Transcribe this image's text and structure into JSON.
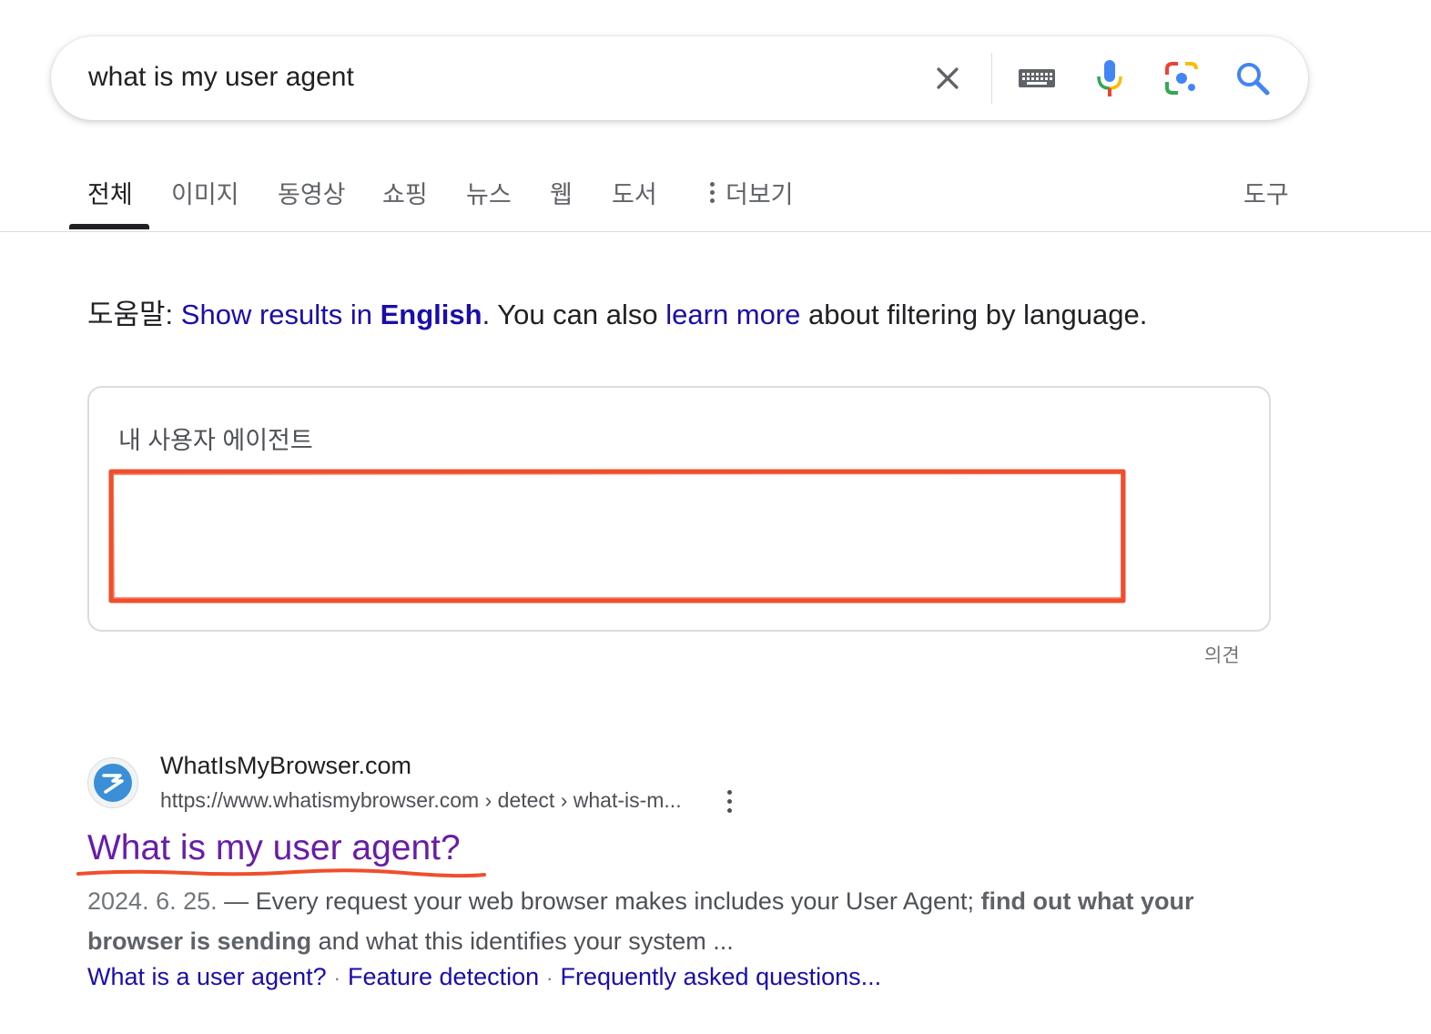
{
  "search": {
    "query": "what is my user agent"
  },
  "icons": {
    "clear": "close-icon",
    "keyboard": "keyboard-icon",
    "mic": "mic-icon",
    "lens": "lens-icon",
    "search": "search-icon"
  },
  "colors": {
    "link": "#1a0dab",
    "visited": "#681da8",
    "annotation": "#f04e2c"
  },
  "tabs": [
    {
      "label": "전체",
      "active": true
    },
    {
      "label": "이미지"
    },
    {
      "label": "동영상"
    },
    {
      "label": "쇼핑"
    },
    {
      "label": "뉴스"
    },
    {
      "label": "웹"
    },
    {
      "label": "도서"
    },
    {
      "label": "더보기"
    }
  ],
  "tools_label": "도구",
  "language_hint": {
    "prefix": "도움말: ",
    "show_results_text": "Show results in ",
    "language": "English",
    "middle": ". You can also ",
    "learn_more": "learn more",
    "suffix": " about filtering by language."
  },
  "ua_card": {
    "title": "내 사용자 에이전트",
    "value": ""
  },
  "feedback_label": "의견",
  "result": {
    "site_name": "WhatIsMyBrowser.com",
    "url": "https://www.whatismybrowser.com › detect › what-is-m...",
    "title": "What is my user agent?",
    "date": "2024. 6. 25.",
    "dash": " — ",
    "snippet_1": "Every request your web browser makes includes your User Agent; ",
    "snippet_bold": "find out what your browser is sending",
    "snippet_2": " and what this identifies your system ...",
    "sitelinks": [
      "What is a user agent?",
      "Feature detection",
      "Frequently asked questions..."
    ]
  }
}
